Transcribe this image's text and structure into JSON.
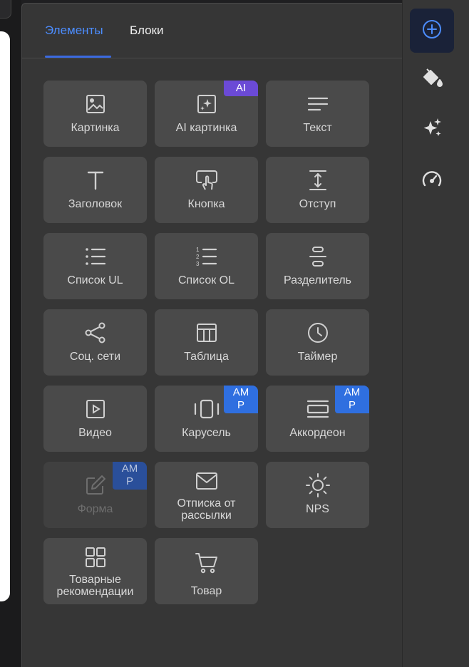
{
  "tabs": [
    {
      "label": "Элементы",
      "active": true
    },
    {
      "label": "Блоки",
      "active": false
    }
  ],
  "accent_color": "#3b6ae0",
  "tiles": [
    {
      "label": "Картинка",
      "icon": "image-icon"
    },
    {
      "label": "AI картинка",
      "icon": "ai-image-icon",
      "badge": "AI"
    },
    {
      "label": "Текст",
      "icon": "text-lines-icon"
    },
    {
      "label": "Заголовок",
      "icon": "heading-icon"
    },
    {
      "label": "Кнопка",
      "icon": "button-tap-icon"
    },
    {
      "label": "Отступ",
      "icon": "spacer-icon"
    },
    {
      "label": "Список UL",
      "icon": "bulleted-list-icon"
    },
    {
      "label": "Список OL",
      "icon": "numbered-list-icon"
    },
    {
      "label": "Разделитель",
      "icon": "divider-icon"
    },
    {
      "label": "Соц. сети",
      "icon": "share-icon"
    },
    {
      "label": "Таблица",
      "icon": "table-icon"
    },
    {
      "label": "Таймер",
      "icon": "clock-icon"
    },
    {
      "label": "Видео",
      "icon": "video-play-icon"
    },
    {
      "label": "Карусель",
      "icon": "carousel-icon",
      "badge": "AM\nP"
    },
    {
      "label": "Аккордеон",
      "icon": "accordion-icon",
      "badge": "AM\nP"
    },
    {
      "label": "Форма",
      "icon": "form-edit-icon",
      "badge": "AM\nP",
      "disabled": true
    },
    {
      "label": "Отписка от рассылки",
      "icon": "envelope-icon"
    },
    {
      "label": "NPS",
      "icon": "sun-icon"
    },
    {
      "label": "Товарные рекомендации",
      "icon": "grid-icon"
    },
    {
      "label": "Товар",
      "icon": "cart-icon"
    }
  ],
  "rail": [
    {
      "icon": "add-circle-icon",
      "active": true
    },
    {
      "icon": "paint-bucket-icon",
      "active": false
    },
    {
      "icon": "sparkles-icon",
      "active": false
    },
    {
      "icon": "speedometer-icon",
      "active": false
    }
  ]
}
